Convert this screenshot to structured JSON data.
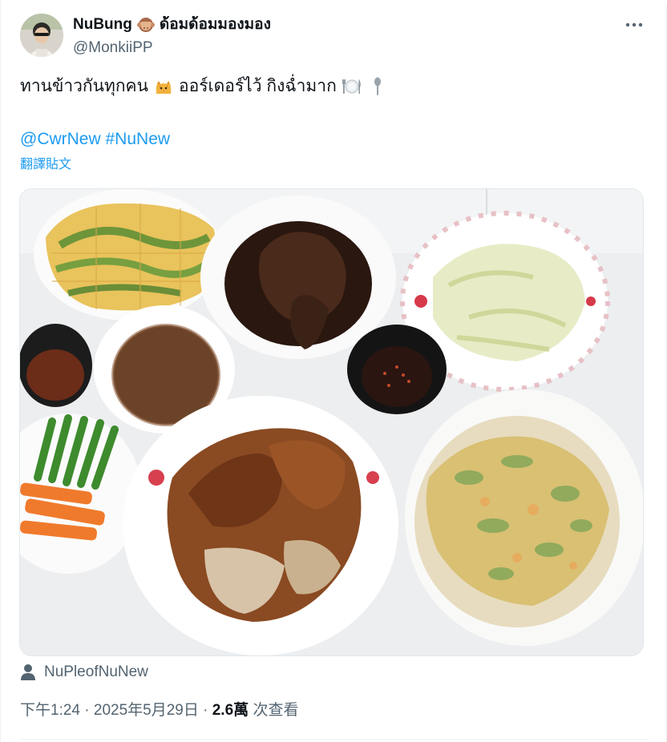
{
  "author": {
    "display_name": "NuBung",
    "name_suffix": "ด้อมด้อมมองมอง",
    "name_emoji": "see-no-evil-monkey",
    "handle": "@MonkiiPP"
  },
  "tweet": {
    "text_part1": "ทานข้าวกันทุกคน",
    "emoji_1": "cat-face",
    "text_part2": "ออร์เดอร์ไว้ กิงฉ่ำมาก",
    "emoji_2": "fork-knife-plate",
    "emoji_3": "spoon",
    "mention": "@CwrNew",
    "hashtag": "#NuNew",
    "translate_label": "翻譯貼文"
  },
  "photo": {
    "subject": "overhead view of Thai dishes on a table"
  },
  "tagged_user": {
    "icon": "person-icon",
    "name": "NuPleofNuNew"
  },
  "meta": {
    "time": "下午1:24",
    "separator": "·",
    "date": "2025年5月29日",
    "views_count": "2.6萬",
    "views_label": "次查看"
  },
  "colors": {
    "link": "#1d9bf0",
    "secondary_text": "#536471",
    "primary_text": "#0f1419"
  }
}
